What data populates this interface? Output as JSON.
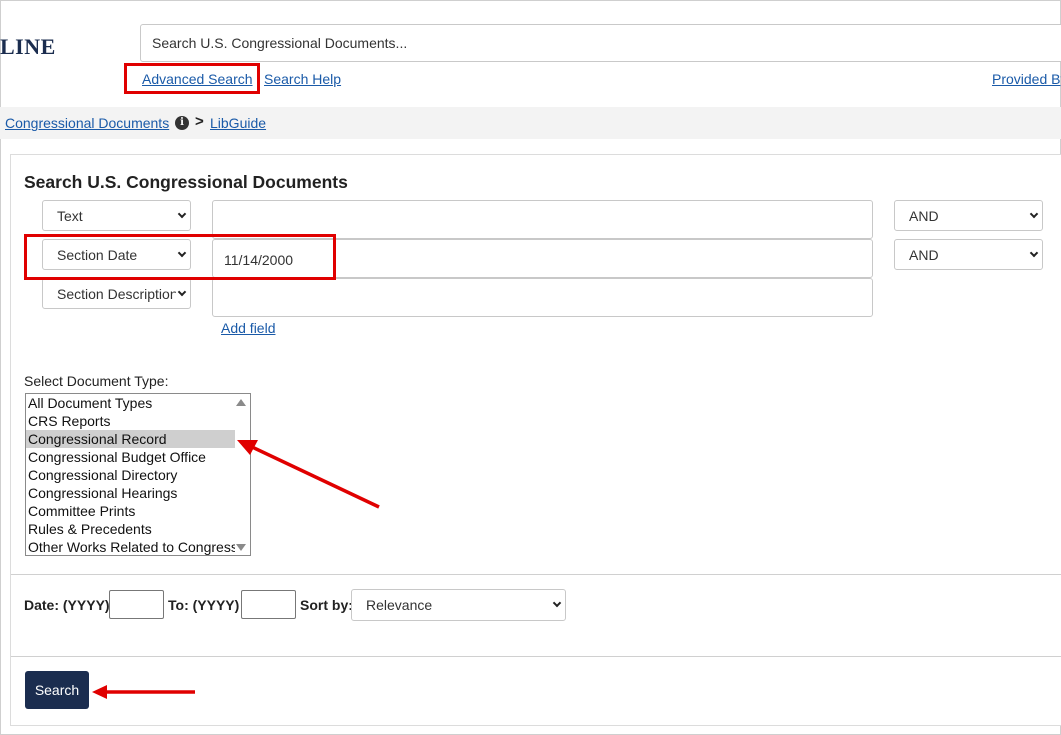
{
  "header": {
    "logo_text": "LINE",
    "search_placeholder": "Search U.S. Congressional Documents...",
    "advanced_search": "Advanced Search",
    "search_help": "Search Help",
    "provided_by": "Provided By"
  },
  "breadcrumb": {
    "item1": "Congressional Documents",
    "info_glyph": "i",
    "chevron_glyph": ">",
    "item2": "LibGuide"
  },
  "form": {
    "title": "Search U.S. Congressional Documents",
    "rows": [
      {
        "field": "Text",
        "value": "",
        "operator": "AND"
      },
      {
        "field": "Section Date",
        "value": "11/14/2000",
        "operator": "AND"
      },
      {
        "field": "Section Description",
        "value": ""
      }
    ],
    "add_field": "Add field",
    "doc_type_label": "Select Document Type:",
    "doc_types": [
      "All Document Types",
      "CRS Reports",
      "Congressional Record",
      "Congressional Budget Office",
      "Congressional Directory",
      "Congressional Hearings",
      "Committee Prints",
      "Rules & Precedents",
      "Other Works Related to Congress"
    ],
    "selected_doc_type": "Congressional Record",
    "date_label": "Date: (YYYY)",
    "to_label": "To: (YYYY)",
    "sort_label": "Sort by:",
    "sort_value": "Relevance",
    "search_button": "Search"
  },
  "colors": {
    "highlight": "#e00000",
    "link": "#1a5aa8",
    "button": "#1b2d4f"
  },
  "icons": [
    "info-icon",
    "chevron-right-icon",
    "chevron-down-icon",
    "scroll-up-icon",
    "scroll-down-icon"
  ]
}
